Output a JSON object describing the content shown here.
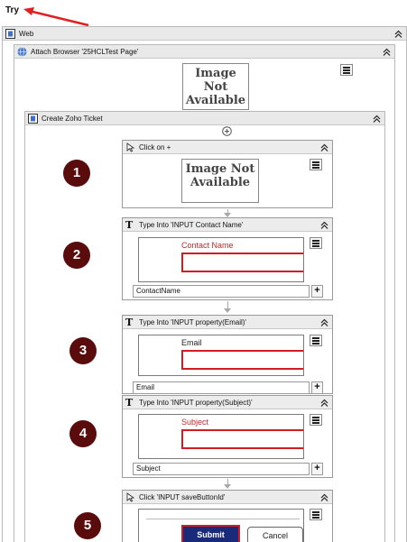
{
  "title": "Try",
  "web": {
    "label": "Web"
  },
  "attach": {
    "label": "Attach Browser '25HCLTest Page'",
    "image_text": "Image Not Available"
  },
  "sequence": {
    "label": "Create Zoho Ticket"
  },
  "step1": {
    "badge": "1",
    "label": "Click on +",
    "image_text": "Image Not Available"
  },
  "step2": {
    "badge": "2",
    "label": "Type Into 'INPUT  Contact Name'",
    "preview_label": "Contact Name",
    "value": "ContactName"
  },
  "step3": {
    "badge": "3",
    "label": "Type Into 'INPUT  property(Email)'",
    "preview_label": "Email",
    "value": "Email"
  },
  "step4": {
    "badge": "4",
    "label": "Type Into 'INPUT  property(Subject)'",
    "preview_label": "Subject",
    "value": "Subject"
  },
  "step5": {
    "badge": "5",
    "label": "Click 'INPUT  saveButtonId'",
    "submit_label": "Submit",
    "cancel_label": "Cancel"
  },
  "plus_label": "+",
  "colors": {
    "accent_red": "#d11d22",
    "badge_bg": "#5a0b0b",
    "submit_bg": "#1a2a7a"
  }
}
